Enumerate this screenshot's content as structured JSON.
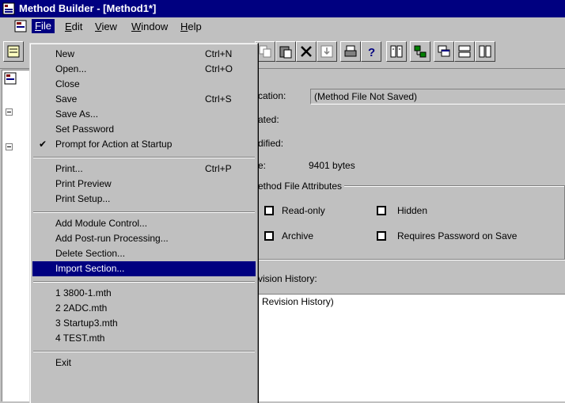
{
  "window": {
    "title": "Method Builder - [Method1*]"
  },
  "menubar": {
    "items": [
      {
        "label": "File",
        "mnemonic": "F",
        "rest": "ile"
      },
      {
        "label": "Edit",
        "mnemonic": "E",
        "rest": "dit"
      },
      {
        "label": "View",
        "mnemonic": "V",
        "rest": "iew"
      },
      {
        "label": "Window",
        "mnemonic": "W",
        "rest": "indow"
      },
      {
        "label": "Help",
        "mnemonic": "H",
        "rest": "elp"
      }
    ]
  },
  "file_menu": {
    "new": {
      "label": "New",
      "shortcut": "Ctrl+N"
    },
    "open": {
      "label": "Open...",
      "shortcut": "Ctrl+O"
    },
    "close": {
      "label": "Close"
    },
    "save": {
      "label": "Save",
      "shortcut": "Ctrl+S"
    },
    "save_as": {
      "label": "Save As..."
    },
    "set_password": {
      "label": "Set Password"
    },
    "prompt_startup": {
      "label": "Prompt for Action at Startup",
      "checked": true,
      "check": "✔"
    },
    "print": {
      "label": "Print...",
      "shortcut": "Ctrl+P"
    },
    "print_preview": {
      "label": "Print Preview"
    },
    "print_setup": {
      "label": "Print Setup..."
    },
    "add_module": {
      "label": "Add Module Control..."
    },
    "add_postrun": {
      "label": "Add Post-run Processing..."
    },
    "delete_section": {
      "label": "Delete Section..."
    },
    "import_section": {
      "label": "Import Section..."
    },
    "recent1": {
      "label": "1 3800-1.mth"
    },
    "recent2": {
      "label": "2 2ADC.mth"
    },
    "recent3": {
      "label": "3 Startup3.mth"
    },
    "recent4": {
      "label": "4 TEST.mth"
    },
    "exit": {
      "label": "Exit"
    }
  },
  "details": {
    "location_label": "cation:",
    "location_value": "(Method File Not Saved)",
    "created_label": "ated:",
    "modified_label": "dified:",
    "size_label": "e:",
    "size_value": "9401 bytes",
    "attributes_title": "ethod File Attributes",
    "read_only": "Read-only",
    "hidden": "Hidden",
    "archive": "Archive",
    "requires_password": "Requires Password on Save",
    "revision_label": "vision History:",
    "revision_value": "Revision History)"
  },
  "colors": {
    "titlebar": "#000080",
    "selection": "#000080",
    "face": "#c0c0c0"
  }
}
